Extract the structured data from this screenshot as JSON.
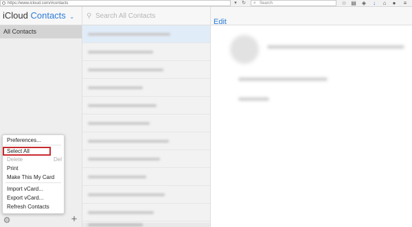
{
  "browser": {
    "url": "https://www.icloud.com/#contacts",
    "search_placeholder": "Search",
    "reload_icon": "reload-icon",
    "back_icon": "chevron-icon"
  },
  "header": {
    "brand_prefix": "iCloud",
    "app_name": "Contacts",
    "app_chevron": "⌄",
    "search_placeholder": "Search All Contacts",
    "edit_label": "Edit"
  },
  "sidebar": {
    "groups": [
      {
        "label": "All Contacts",
        "selected": true
      }
    ]
  },
  "menu": {
    "items": [
      {
        "label": "Preferences...",
        "shortcut": "",
        "disabled": false
      },
      {
        "label": "Select All",
        "shortcut": "",
        "disabled": false,
        "highlighted": true
      },
      {
        "label": "Delete",
        "shortcut": "Del",
        "disabled": true
      },
      {
        "label": "Print",
        "shortcut": "",
        "disabled": false
      },
      {
        "label": "Make This My Card",
        "shortcut": "",
        "disabled": false
      },
      {
        "label": "Import vCard...",
        "shortcut": "",
        "disabled": false
      },
      {
        "label": "Export vCard...",
        "shortcut": "",
        "disabled": false
      },
      {
        "label": "Refresh Contacts",
        "shortcut": "",
        "disabled": false
      }
    ]
  },
  "colors": {
    "accent": "#2b7bd8",
    "highlight_box": "#c8282c",
    "selected_row": "#e1ecf9",
    "sidebar_selected": "#d4d4d4"
  },
  "icons": [
    "info-icon",
    "search-icon",
    "star-icon",
    "reading-list-icon",
    "pocket-icon",
    "download-icon",
    "home-icon",
    "chat-icon",
    "menu-icon",
    "gear-icon",
    "plus-icon"
  ]
}
